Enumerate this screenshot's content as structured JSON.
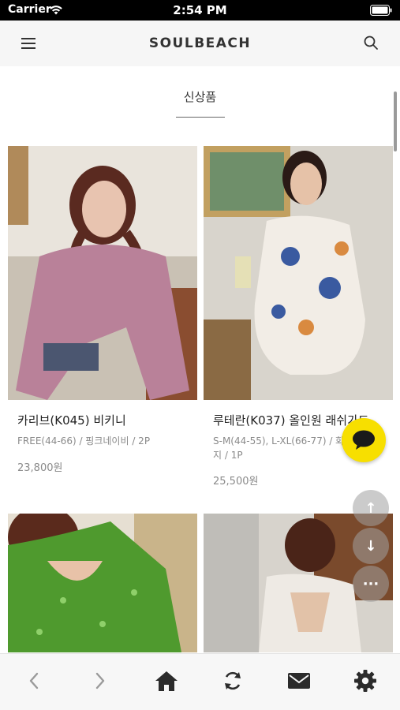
{
  "status": {
    "carrier": "Carrier",
    "time": "2:54 PM"
  },
  "header": {
    "brand": "SOULBEACH",
    "menu_icon": "menu-icon",
    "search_icon": "search-icon"
  },
  "section": {
    "title": "신상품"
  },
  "products": [
    {
      "name": "카리브(K045) 비키니",
      "option": "FREE(44-66) / 핑크네이비 / 2P",
      "price": "23,800원"
    },
    {
      "name": "루테란(K037) 올인원 래쉬가드",
      "option_line1": "S-M(44-55), L-XL(66-77) / 화이트베이",
      "option_line2": "지 / 1P",
      "price": "25,500원"
    },
    {
      "name": "",
      "option": "",
      "price": ""
    },
    {
      "name": "",
      "option": "",
      "price": ""
    }
  ],
  "floating": {
    "kakao_icon": "kakao-chat-icon",
    "up_label": "↑",
    "down_label": "↓",
    "more_label": "···"
  },
  "bottom_nav": {
    "back_icon": "chevron-left-icon",
    "forward_icon": "chevron-right-icon",
    "home_icon": "home-icon",
    "refresh_icon": "refresh-icon",
    "mail_icon": "mail-icon",
    "settings_icon": "gear-icon"
  },
  "colors": {
    "accent": "#f7df00",
    "status_bar": "#000000",
    "header_bg": "#f6f6f6"
  }
}
